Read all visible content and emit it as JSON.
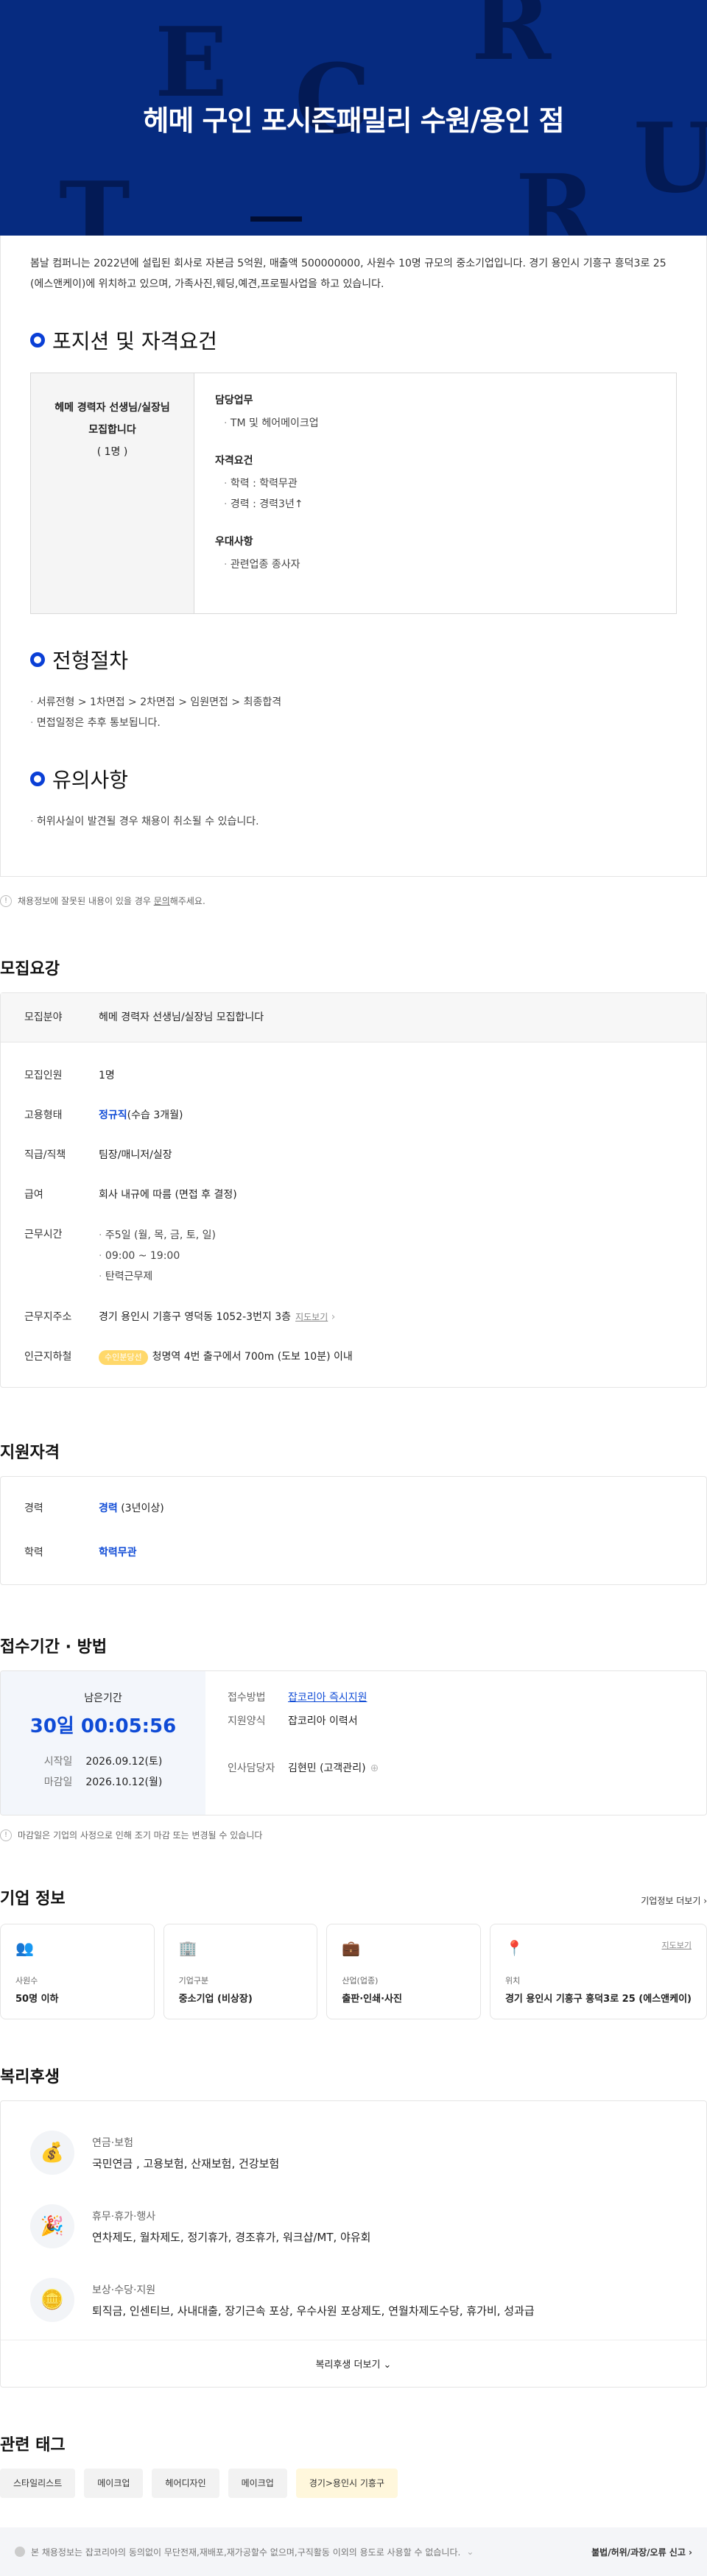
{
  "hero": {
    "title": "헤메 구인 포시즌패밀리 수원/용인 점",
    "bg_letters": [
      "E",
      "R",
      "C",
      "U",
      "T",
      "R"
    ]
  },
  "intro": "봄날 컴퍼니는 2022년에 설립된 회사로 자본금 5억원, 매출액 500000000, 사원수 10명 규모의 중소기업입니다. 경기 용인시 기흥구 흥덕3로 25 (에스앤케이)에 위치하고 있으며, 가족사진,웨딩,예견,프로필사업을 하고 있습니다.",
  "position": {
    "heading": "포지션 및 자격요건",
    "title": "헤메 경력자 선생님/실장님 모집합니다",
    "count": "( 1명 )",
    "duty_title": "담당업무",
    "duties": [
      "TM 및 헤어메이크업"
    ],
    "req_title": "자격요건",
    "reqs": [
      "학력 : 학력무관",
      "경력 : 경력3년↑"
    ],
    "pref_title": "우대사항",
    "prefs": [
      "관련업종 종사자"
    ]
  },
  "process": {
    "heading": "전형절차",
    "items": [
      "서류전형 > 1차면접 > 2차면접 > 임원면접 > 최종합격",
      "면접일정은 추후 통보됩니다."
    ]
  },
  "caution": {
    "heading": "유의사항",
    "items": [
      "허위사실이 발견될 경우 채용이 취소될 수 있습니다."
    ]
  },
  "report_notice": {
    "prefix": "채용정보에 잘못된 내용이 있을 경우 ",
    "link": "문의",
    "suffix": "해주세요."
  },
  "recruit": {
    "heading": "모집요강",
    "field_k": "모집분야",
    "field_v": "헤메 경력자 선생님/실장님 모집합니다",
    "num_k": "모집인원",
    "num_v": "1명",
    "type_k": "고용형태",
    "type_v": "정규직",
    "type_extra": "(수습 3개월)",
    "rank_k": "직급/직책",
    "rank_v": "팀장/매니저/실장",
    "pay_k": "급여",
    "pay_v": "회사 내규에 따름 (면접 후 결정)",
    "hours_k": "근무시간",
    "hours": [
      "주5일 (월, 목, 금, 토, 일)",
      "09:00 ~ 19:00",
      "탄력근무제"
    ],
    "addr_k": "근무지주소",
    "addr_v": "경기 용인시 기흥구 영덕동 1052-3번지 3층",
    "addr_map": "지도보기",
    "station_k": "인근지하철",
    "station_badge": "수인분당선",
    "station_v": "청명역 4번 출구에서 700m (도보 10분) 이내"
  },
  "qual": {
    "heading": "지원자격",
    "career_k": "경력",
    "career_v": "경력",
    "career_extra": "(3년이상)",
    "edu_k": "학력",
    "edu_v": "학력무관"
  },
  "apply": {
    "heading": "접수기간 · 방법",
    "remain_label": "남은기간",
    "countdown": "30일 00:05:56",
    "start_k": "시작일",
    "start_v": "2026.09.12(토)",
    "end_k": "마감일",
    "end_v": "2026.10.12(월)",
    "method_k": "접수방법",
    "method_v": "잡코리아 즉시지원",
    "form_k": "지원양식",
    "form_v": "잡코리아 이력서",
    "hr_k": "인사담당자",
    "hr_v": "김현민 (고객관리)",
    "notice": "마감일은 기업의 사정으로 인해 조기 마감 또는 변경될 수 있습니다"
  },
  "company": {
    "heading": "기업 정보",
    "more": "기업정보 더보기",
    "cards": [
      {
        "icon": "👥",
        "label": "사원수",
        "value": "50명 이하"
      },
      {
        "icon": "🏢",
        "label": "기업구분",
        "value": "중소기업 (비상장)"
      },
      {
        "icon": "💼",
        "label": "산업(업종)",
        "value": "출판·인쇄·사진"
      },
      {
        "icon": "📍",
        "label": "위치",
        "value": "경기 용인시 기흥구 흥덕3로 25 (에스앤케이)",
        "link": "지도보기"
      }
    ]
  },
  "welfare": {
    "heading": "복리후생",
    "items": [
      {
        "icon": "💰",
        "title": "연금·보험",
        "value": "국민연금 , 고용보험, 산재보험, 건강보험"
      },
      {
        "icon": "🎉",
        "title": "휴무·휴가·행사",
        "value": "연차제도, 월차제도, 정기휴가, 경조휴가, 워크샵/MT, 야유회"
      },
      {
        "icon": "🪙",
        "title": "보상·수당·지원",
        "value": "퇴직금, 인센티브, 사내대출, 장기근속 포상, 우수사원 포상제도, 연월차제도수당, 휴가비, 성과급"
      }
    ],
    "more": "복리후생 더보기"
  },
  "tags": {
    "heading": "관련 태그",
    "items": [
      "스타일리스트",
      "메이크업",
      "헤어디자인",
      "메이크업",
      "경기>용인시 기흥구"
    ]
  },
  "footer": {
    "notice": "본 채용정보는 잡코리아의 동의없이 무단전재,재배포,재가공할수 없으며,구직활동 이외의 용도로 사용할 수 없습니다.",
    "report": "불법/허위/과장/오류 신고"
  }
}
